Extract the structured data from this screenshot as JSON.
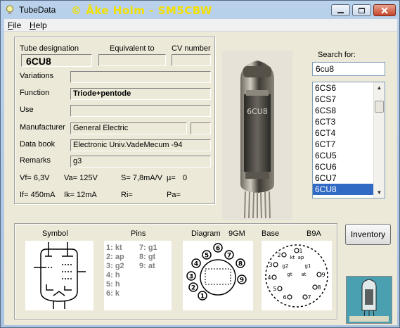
{
  "window": {
    "title": "TubeData",
    "copyright": "© Åke Holm - SM5CBW"
  },
  "menu": {
    "file": "File",
    "file_key": "F",
    "file_rest": "ile",
    "help_key": "H",
    "help_rest": "elp"
  },
  "fields": {
    "designation_label": "Tube designation",
    "equivalent_label": "Equivalent to",
    "cv_label": "CV number",
    "designation": "6CU8",
    "equivalent": "",
    "cv": "",
    "variations_label": "Variations",
    "variations": "",
    "function_label": "Function",
    "function": "Triode+pentode",
    "use_label": "Use",
    "use": "",
    "manufacturer_label": "Manufacturer",
    "manufacturer": "General Electric",
    "manufacturer_extra": "",
    "databook_label": "Data book",
    "databook": "Electronic Univ.VadeMecum -94",
    "remarks_label": "Remarks",
    "remarks": "g3"
  },
  "params": {
    "vf": "Vf= 6,3V",
    "va": "Va= 125V",
    "s": "S= 7,8mA/V",
    "mu": "µ=",
    "mu_val": "0",
    "if": "If= 450mA",
    "ik": "Ik=  12mA",
    "ri": "Ri=",
    "pa": "Pa="
  },
  "search": {
    "label": "Search for:",
    "value": "6cu8"
  },
  "list": {
    "items": [
      "6CS6",
      "6CS7",
      "6CS8",
      "6CT3",
      "6CT4",
      "6CT7",
      "6CU5",
      "6CU6",
      "6CU7",
      "6CU8"
    ],
    "selected_index": 9
  },
  "bottom": {
    "symbol_label": "Symbol",
    "pins_label": "Pins",
    "diagram_label": "Diagram",
    "diagram_code": "9GM",
    "base_label": "Base",
    "base_code": "B9A",
    "pins_col1": [
      "1: kt",
      "2: ap",
      "3: g2",
      "4: h",
      "5: h",
      "6: k"
    ],
    "pins_col2": [
      "7: g1",
      "8: gt",
      "9: at"
    ],
    "diagram_pins": [
      "1",
      "2",
      "3",
      "4",
      "5",
      "6",
      "7",
      "8",
      "9"
    ],
    "base_labels": [
      "1",
      "2",
      "3",
      "4",
      "5",
      "6",
      "7",
      "8",
      "9",
      "kt",
      "ap",
      "g2",
      "g1",
      "gt",
      "at"
    ]
  },
  "buttons": {
    "inventory": "Inventory"
  },
  "colors": {
    "titlebar": "#b9d1ea",
    "copyright": "#f2e000",
    "face": "#ece9d8",
    "selection": "#316ac5"
  }
}
